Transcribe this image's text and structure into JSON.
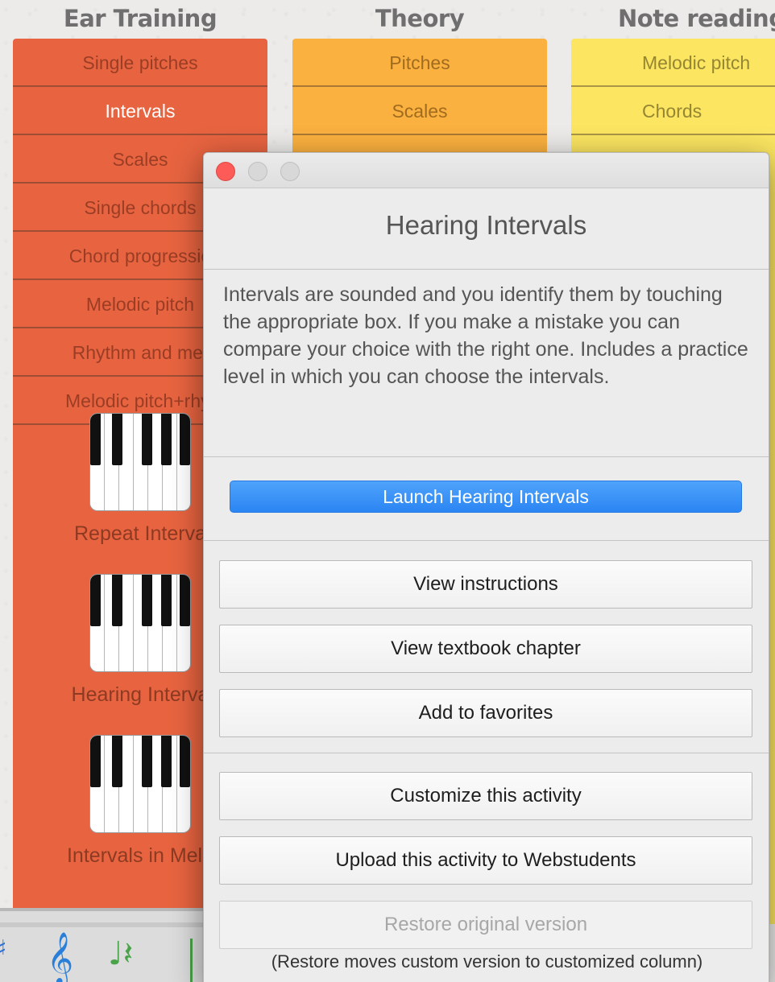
{
  "columns": {
    "ear": {
      "heading": "Ear Training",
      "items": [
        "Single pitches",
        "Intervals",
        "Scales",
        "Single chords",
        "Chord progressio",
        "Melodic pitch",
        "Rhythm and met",
        "Melodic pitch+rhyt"
      ],
      "selected_index": 1,
      "activities": [
        "Repeat Interva",
        "Hearing Interva",
        "Intervals in Melo"
      ]
    },
    "theory": {
      "heading": "Theory",
      "items": [
        "Pitches",
        "Scales"
      ]
    },
    "notes": {
      "heading": "Note reading",
      "items": [
        "Melodic pitch",
        "Chords"
      ]
    }
  },
  "toolbar_icons": [
    "sharp-icon",
    "treble-clef-icon",
    "notes-rest-icon"
  ],
  "dialog": {
    "title": "Hearing Intervals",
    "description": "Intervals are sounded and you identify them by touching the appropriate box. If you make a mistake you can compare your choice with the right one. Includes a practice level in which you can choose the intervals.",
    "launch_label": "Launch Hearing Intervals",
    "view_instructions_label": "View instructions",
    "view_textbook_label": "View textbook chapter",
    "add_favorites_label": "Add to favorites",
    "customize_label": "Customize this activity",
    "upload_label": "Upload this activity to Webstudents",
    "restore_label": "Restore original version",
    "restore_note": "(Restore moves custom version to customized column)"
  },
  "colors": {
    "ear_training": "#e86440",
    "theory": "#fbb13f",
    "note_reading": "#fbe561",
    "launch_button": "#2b85f3",
    "close_button": "#fc5b57"
  }
}
